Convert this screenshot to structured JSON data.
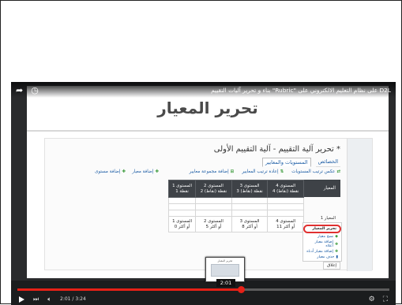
{
  "video": {
    "title": "بناء و تحرير آليات التقييم \"Rubric\" على نظام التعليم الالكتروني على D2L",
    "title_icons": [
      "share-icon",
      "clock-icon"
    ],
    "slide_title": "تحرير المعيار",
    "current_time": "2:01",
    "time_display": "2:01 / 3:24",
    "progress": 0.6,
    "thumb_time": "2:01"
  },
  "d2l": {
    "page_title": "تحرير آلية التقييم - آلية التقييم الأولى *",
    "tabs": [
      "الخصائص",
      "المستويات والمعايير"
    ],
    "toolbar": [
      "عكس ترتيب المستويات",
      "إعادة ترتيب المعايير",
      "إضافة مجموعة معايير"
    ],
    "left_actions": [
      "إضافة مستوى",
      "إضافة معيار"
    ],
    "criteria_header": "المعيار",
    "levels": [
      {
        "name": "المستوى 4",
        "points": "4 نقطة (نقاط)"
      },
      {
        "name": "المستوى 3",
        "points": "3 نقطة (نقاط)"
      },
      {
        "name": "المستوى 2",
        "points": "2 نقطة (نقاط)"
      },
      {
        "name": "المستوى 1",
        "points": "1 نقطة"
      }
    ],
    "overall_levels": [
      {
        "name": "المستوى 4",
        "range": "11 أو أكثر"
      },
      {
        "name": "المستوى 3",
        "range": "8 أو أكثر"
      },
      {
        "name": "المستوى 2",
        "range": "5 أو أكثر"
      },
      {
        "name": "المستوى 1",
        "range": "0 أو أكثر"
      }
    ],
    "criterion_label": "المعيار 1",
    "menu": [
      "تحرير المعيار",
      "نسخ معيار",
      "إضافة معيار أعلاه",
      "إضافة معيار أدناه",
      "حذف معيار"
    ],
    "close_label": "إغلاق"
  }
}
